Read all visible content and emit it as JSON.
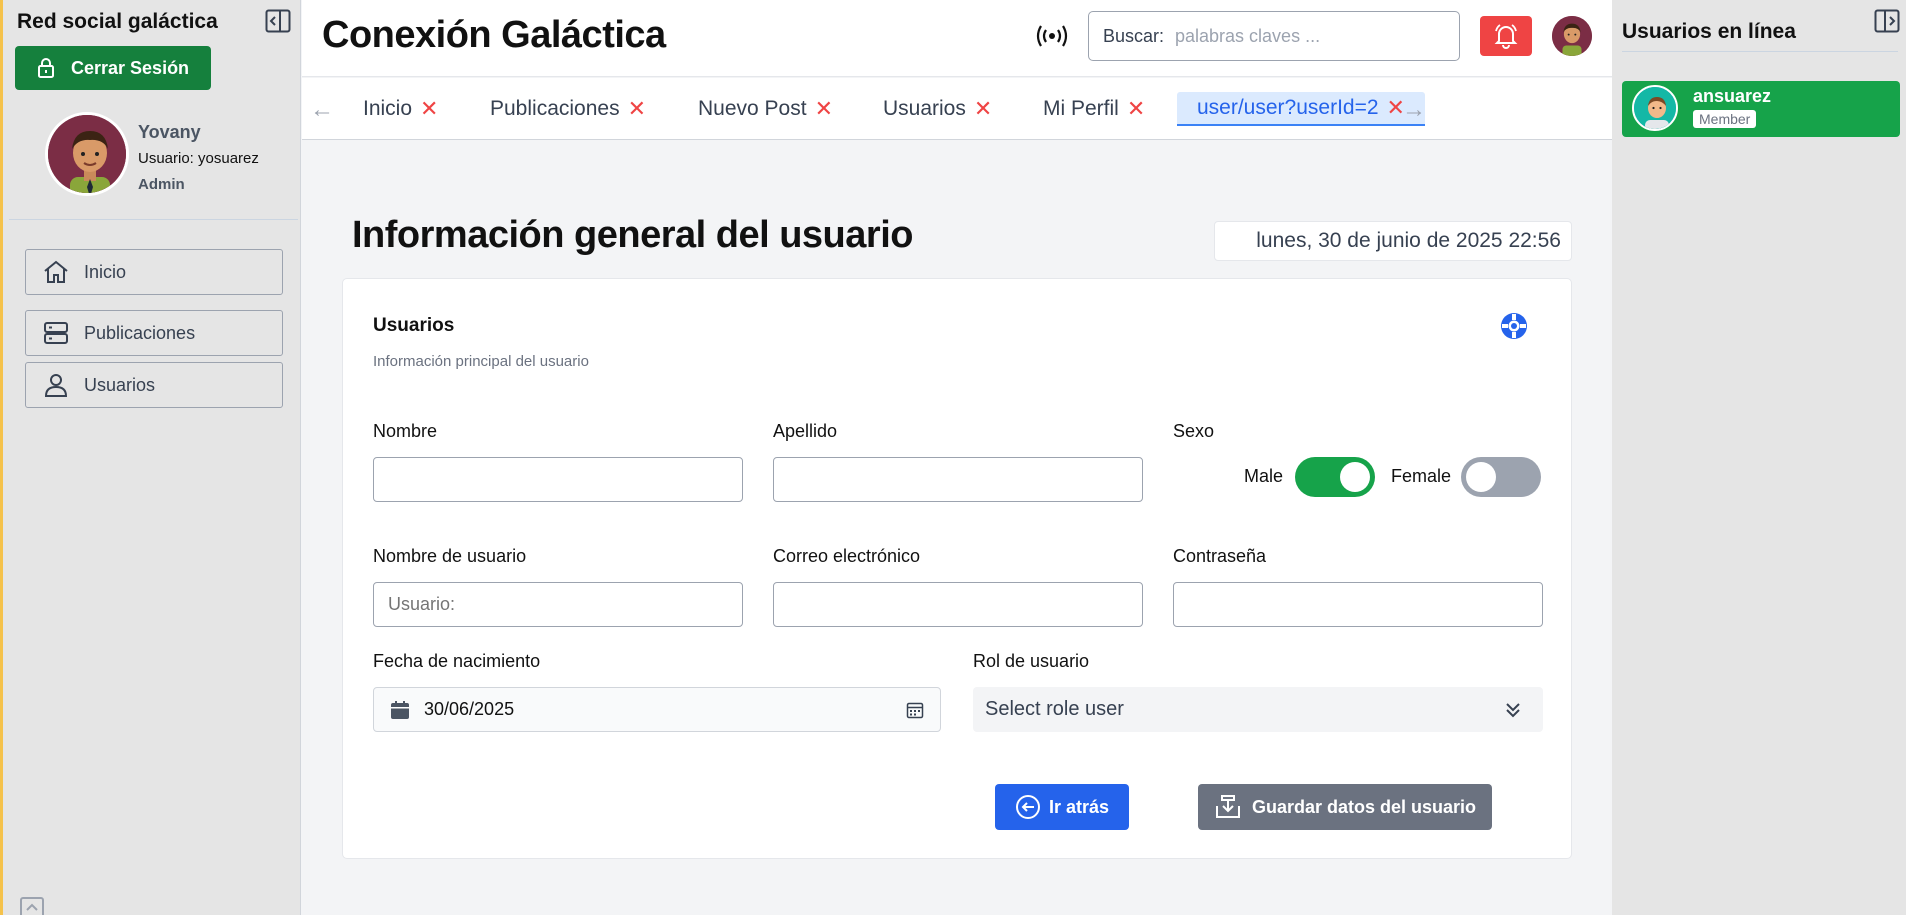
{
  "left_sidebar": {
    "brand": "Red social galáctica",
    "logout_label": "Cerrar Sesión",
    "user": {
      "name": "Yovany",
      "login": "Usuario: yosuarez",
      "role": "Admin"
    },
    "nav": [
      {
        "label": "Inicio",
        "icon": "home-icon"
      },
      {
        "label": "Publicaciones",
        "icon": "server-icon"
      },
      {
        "label": "Usuarios",
        "icon": "user-icon"
      }
    ]
  },
  "header": {
    "title": "Conexión Galáctica",
    "search_label": "Buscar:",
    "search_placeholder": "palabras claves ...",
    "search_value": ""
  },
  "tabs": [
    {
      "label": "Inicio",
      "active": false
    },
    {
      "label": "Publicaciones",
      "active": false
    },
    {
      "label": "Nuevo Post",
      "active": false
    },
    {
      "label": "Usuarios",
      "active": false
    },
    {
      "label": "Mi Perfil",
      "active": false
    },
    {
      "label": "user/user?userId=2",
      "active": true
    }
  ],
  "main": {
    "title": "Información general del usuario",
    "datetime": "lunes, 30 de junio de 2025 22:56",
    "card": {
      "title": "Usuarios",
      "subtitle": "Información principal del usuario",
      "fields": {
        "nombre": {
          "label": "Nombre",
          "value": ""
        },
        "apellido": {
          "label": "Apellido",
          "value": ""
        },
        "sexo": {
          "label": "Sexo",
          "male_label": "Male",
          "female_label": "Female",
          "male_on": true,
          "female_on": false
        },
        "username": {
          "label": "Nombre de usuario",
          "placeholder": "Usuario:"
        },
        "email": {
          "label": "Correo electrónico",
          "value": ""
        },
        "password": {
          "label": "Contraseña",
          "value": ""
        },
        "birthdate": {
          "label": "Fecha de nacimiento",
          "value": "30/06/2025"
        },
        "role": {
          "label": "Rol de usuario",
          "value": "Select role user"
        }
      },
      "back_label": "Ir atrás",
      "save_label": "Guardar datos del usuario"
    }
  },
  "right_sidebar": {
    "title": "Usuarios en línea",
    "online": [
      {
        "name": "ansuarez",
        "badge": "Member"
      }
    ]
  },
  "colors": {
    "primary_green": "#15803d",
    "online_green": "#16a34a",
    "alert_red": "#ef4444",
    "primary_blue": "#2563eb",
    "save_gray": "#6b7280",
    "sidebar_accent": "#f5c24b"
  }
}
